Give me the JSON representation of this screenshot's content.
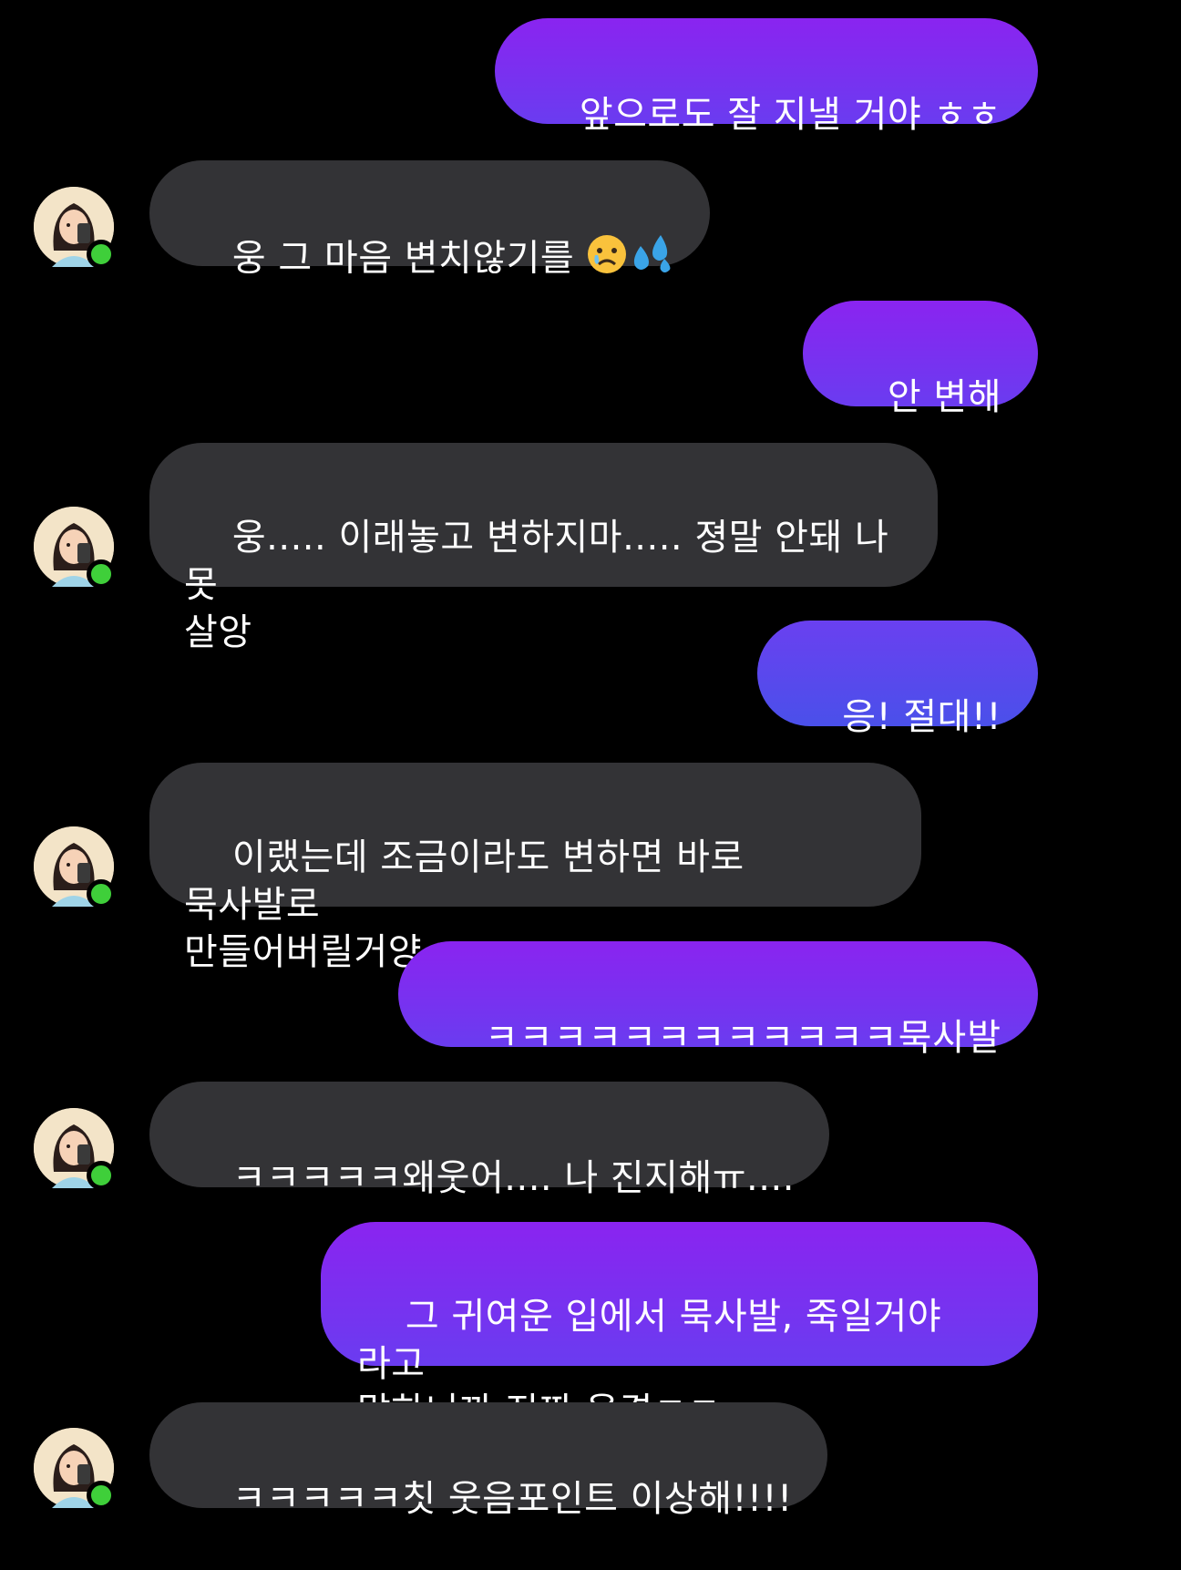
{
  "conversation": {
    "messages": [
      {
        "direction": "sent",
        "text": "앞으로도 잘 지낼 거야 ㅎㅎ"
      },
      {
        "direction": "received",
        "text": "웅 그 마음 변치않기를 ",
        "emoji": [
          "sad-relieved-face-icon",
          "sweat-droplets-icon"
        ]
      },
      {
        "direction": "sent",
        "text": "안 변해"
      },
      {
        "direction": "received",
        "text": "웅..... 이래놓고 변하지마..... 졍말 안돼 나 못\n살앙"
      },
      {
        "direction": "sent",
        "text": "응! 절대!!"
      },
      {
        "direction": "received",
        "text": "이랬는데 조금이라도 변하면 바로 묵사발로\n만들어버릴거양 ><"
      },
      {
        "direction": "sent",
        "text": "ㅋㅋㅋㅋㅋㅋㅋㅋㅋㅋㅋㅋ묵사발"
      },
      {
        "direction": "received",
        "text": "ㅋㅋㅋㅋㅋ왜웃어.... 나 진지해ㅠ...."
      },
      {
        "direction": "sent",
        "text": "그 귀여운 입에서 묵사발, 죽일거야 라고\n말하니까 진짜 웃겼ㅋㅋ"
      },
      {
        "direction": "received",
        "text": "ㅋㅋㅋㅋㅋ칫 웃음포인트 이상해!!!!"
      }
    ]
  },
  "contact": {
    "avatar_icon": "contact-avatar-icon",
    "status": "online"
  },
  "colors": {
    "background": "#000000",
    "sent_bubble_top": "#8a24f0",
    "sent_bubble_bottom": "#4a50ea",
    "received_bubble": "#333336",
    "online_dot": "#3fcf3a",
    "text": "#ffffff"
  }
}
